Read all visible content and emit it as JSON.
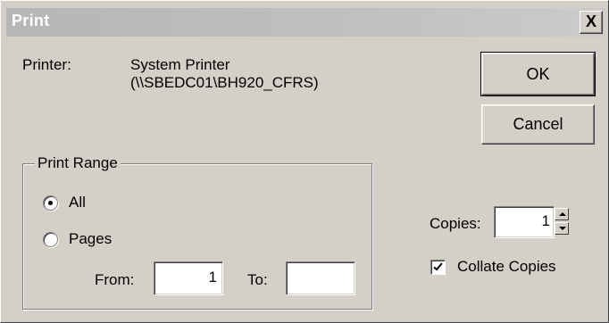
{
  "window": {
    "title": "Print",
    "close_symbol": "X"
  },
  "printer": {
    "label": "Printer:",
    "name_line1": "System Printer",
    "name_line2": "(\\\\SBEDC01\\BH920_CFRS)"
  },
  "buttons": {
    "ok_label": "OK",
    "cancel_label": "Cancel"
  },
  "print_range": {
    "legend": "Print Range",
    "selected": "All",
    "options": [
      {
        "label": "All",
        "checked": true
      },
      {
        "label": "Pages",
        "checked": false
      }
    ],
    "from_label": "From:",
    "from_value": "1",
    "to_label": "To:",
    "to_value": ""
  },
  "copies": {
    "label": "Copies:",
    "value": "1",
    "collate_label": "Collate Copies",
    "collate_checked": true
  },
  "icons": {
    "close": "close-icon",
    "spin_up": "chevron-up-icon",
    "spin_down": "chevron-down-icon",
    "check": "checkmark-icon"
  },
  "colors": {
    "face": "#d4d0c8",
    "titlebar": "#c0c0c0",
    "title_text": "#ffffff"
  }
}
